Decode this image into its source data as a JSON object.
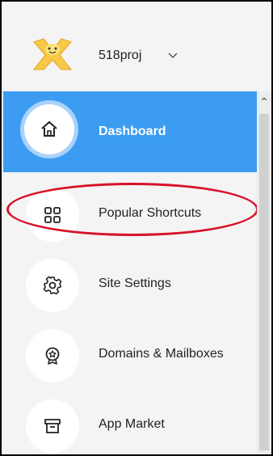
{
  "site": {
    "name": "518proj",
    "logo_icon": "wix-star-logo-icon",
    "chevron_icon": "chevron-down-icon"
  },
  "nav": {
    "items": [
      {
        "label": "Dashboard",
        "icon": "home-icon",
        "active": true
      },
      {
        "label": "Popular Shortcuts",
        "icon": "grid-icon",
        "active": false
      },
      {
        "label": "Site Settings",
        "icon": "gear-icon",
        "active": false
      },
      {
        "label": "Domains & Mailboxes",
        "icon": "badge-icon",
        "active": false
      },
      {
        "label": "App Market",
        "icon": "store-icon",
        "active": false
      }
    ]
  },
  "colors": {
    "active_bg": "#3b9cf2",
    "annotation": "#d7132a",
    "panel_bg": "#f4f4f4"
  },
  "scrollbar": {
    "up_arrow_icon": "caret-up-icon"
  }
}
